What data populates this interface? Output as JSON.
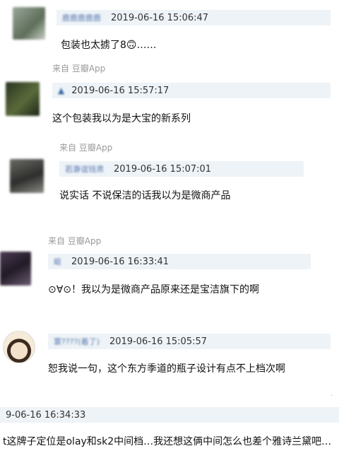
{
  "comments": [
    {
      "username": "鹿鹿鹿鹿鹿",
      "time": "2019-06-16 15:06:47",
      "text": "包装也太掳了8🙃……",
      "avatar_color": "#7a8a76"
    },
    {
      "username": "▲",
      "time": "2019-06-16 15:57:17",
      "text": "这个包装我以为是大宝的新系列",
      "avatar_color": "#3a4a2a"
    },
    {
      "username": "若瀞谊钱肃",
      "time": "2019-06-16 15:07:01",
      "text": "说实话 不说保洁的话我以为是微商产品",
      "avatar_color": "#4a4a48"
    },
    {
      "username": "岖",
      "time": "2019-06-16 16:33:41",
      "text": "⊙∀⊙！我以为是微商产品原来还是宝洁旗下的啊",
      "avatar_color": "#3a2e3c"
    },
    {
      "username": "寰????(着了)",
      "time": "2019-06-16 15:05:57",
      "text": "恕我说一句，这个东方季道的瓶子设计有点不上档次啊",
      "avatar_color": "#e9d6c0"
    },
    {
      "username": "",
      "time": "9-06-16 16:34:33",
      "text": "t这牌子定位是olay和sk2中间档…我还想这俩中间怎么也差个雅诗兰黛吧…",
      "avatar_color": ""
    }
  ],
  "sources": [
    "来自 豆瓣App",
    "来自 豆瓣App",
    "来自 豆瓣App"
  ],
  "misc": {
    "corner_text": "."
  }
}
